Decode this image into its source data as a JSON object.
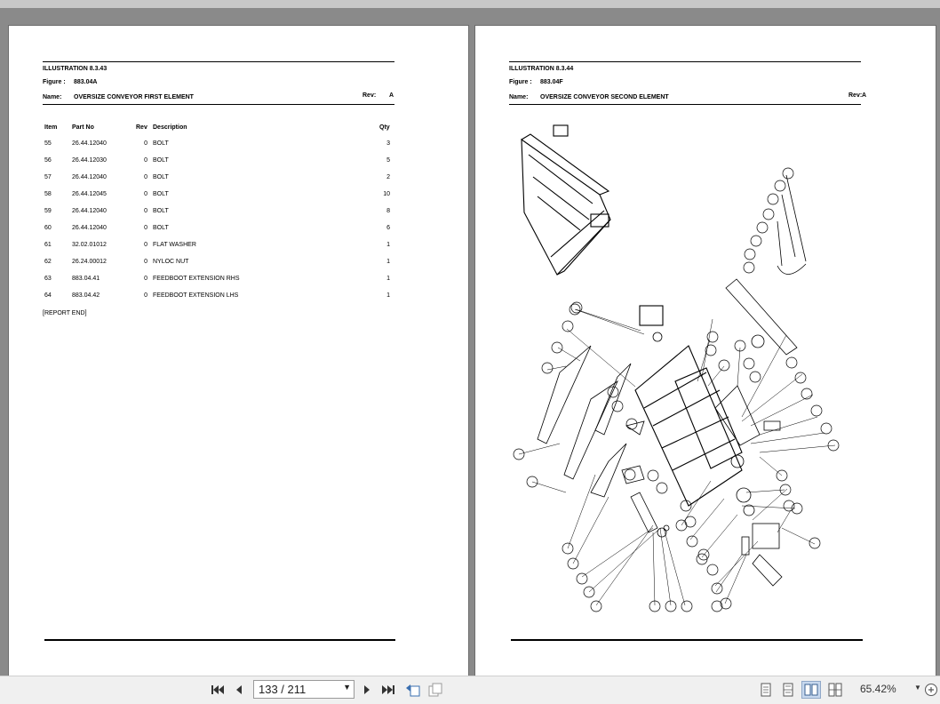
{
  "left_page": {
    "illustration": "ILLUSTRATION 8.3.43",
    "figure_label": "Figure :",
    "figure_value": "883.04A",
    "name_label": "Name:",
    "name_value": "OVERSIZE CONVEYOR FIRST ELEMENT",
    "rev_label": "Rev:",
    "rev_value": "A",
    "columns": {
      "item": "Item",
      "part_no": "Part No",
      "rev": "Rev",
      "description": "Description",
      "qty": "Qty"
    },
    "rows": [
      {
        "item": "55",
        "part_no": "26.44.12040",
        "rev": "0",
        "description": "BOLT",
        "qty": "3"
      },
      {
        "item": "56",
        "part_no": "26.44.12030",
        "rev": "0",
        "description": "BOLT",
        "qty": "5"
      },
      {
        "item": "57",
        "part_no": "26.44.12040",
        "rev": "0",
        "description": "BOLT",
        "qty": "2"
      },
      {
        "item": "58",
        "part_no": "26.44.12045",
        "rev": "0",
        "description": "BOLT",
        "qty": "10"
      },
      {
        "item": "59",
        "part_no": "26.44.12040",
        "rev": "0",
        "description": "BOLT",
        "qty": "8"
      },
      {
        "item": "60",
        "part_no": "26.44.12040",
        "rev": "0",
        "description": "BOLT",
        "qty": "6"
      },
      {
        "item": "61",
        "part_no": "32.02.01012",
        "rev": "0",
        "description": "FLAT WASHER",
        "qty": "1"
      },
      {
        "item": "62",
        "part_no": "26.24.00012",
        "rev": "0",
        "description": "NYLOC NUT",
        "qty": "1"
      },
      {
        "item": "63",
        "part_no": "883.04.41",
        "rev": "0",
        "description": "FEEDBOOT EXTENSION RHS",
        "qty": "1"
      },
      {
        "item": "64",
        "part_no": "883.04.42",
        "rev": "0",
        "description": "FEEDBOOT EXTENSION LHS",
        "qty": "1"
      }
    ],
    "report_end": "[REPORT END]"
  },
  "right_page": {
    "illustration": "ILLUSTRATION 8.3.44",
    "figure_label": "Figure :",
    "figure_value": "883.04F",
    "name_label": "Name:",
    "name_value": "OVERSIZE CONVEYOR SECOND ELEMENT",
    "rev_label": "Rev:",
    "rev_value": "A",
    "drawing_icon": "exploded-conveyor-drawing"
  },
  "toolbar": {
    "page_display": "133 / 211",
    "zoom": "65.42%",
    "icons": [
      "first-page-icon",
      "prev-page-icon",
      "next-page-icon",
      "last-page-icon",
      "prev-view-icon",
      "next-view-icon",
      "single-page-icon",
      "continuous-icon",
      "facing-icon",
      "continuous-facing-icon",
      "zoom-dropdown-icon",
      "zoom-in-icon"
    ]
  }
}
